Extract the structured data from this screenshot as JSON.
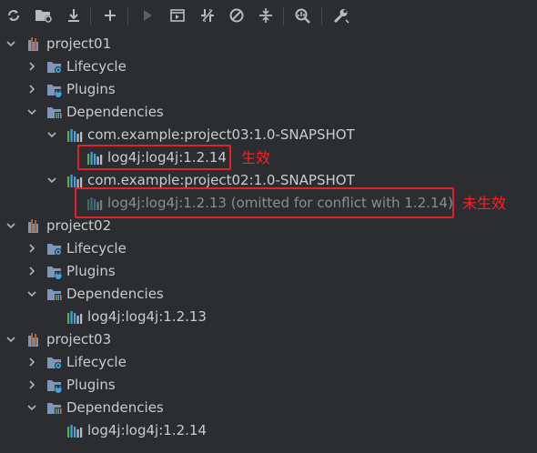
{
  "toolbar": {
    "buttons": [
      {
        "name": "reload-icon"
      },
      {
        "name": "folder-generate-icon"
      },
      {
        "name": "download-icon"
      },
      {
        "name": "add-icon"
      },
      {
        "name": "run-icon"
      },
      {
        "name": "execute-goal-icon"
      },
      {
        "name": "toggle-offline-icon"
      },
      {
        "name": "skip-tests-icon"
      },
      {
        "name": "collapse-all-icon"
      },
      {
        "name": "analyze-dependencies-icon"
      },
      {
        "name": "settings-wrench-icon"
      }
    ]
  },
  "tree": {
    "project01": {
      "label": "project01",
      "lifecycle": "Lifecycle",
      "plugins": "Plugins",
      "dependencies": "Dependencies",
      "dep_a": "com.example:project03:1.0-SNAPSHOT",
      "dep_a_child": "log4j:log4j:1.2.14",
      "dep_b": "com.example:project02:1.0-SNAPSHOT",
      "dep_b_child": "log4j:log4j:1.2.13 (omitted for conflict with 1.2.14)"
    },
    "project02": {
      "label": "project02",
      "lifecycle": "Lifecycle",
      "plugins": "Plugins",
      "dependencies": "Dependencies",
      "dep": "log4j:log4j:1.2.13"
    },
    "project03": {
      "label": "project03",
      "lifecycle": "Lifecycle",
      "plugins": "Plugins",
      "dependencies": "Dependencies",
      "dep": "log4j:log4j:1.2.14"
    }
  },
  "annotations": {
    "effective": "生效",
    "not_effective": "未生效"
  },
  "colors": {
    "background": "#2b2d30",
    "text": "#c9ccd1",
    "muted_text": "#8a8e95",
    "annotation_red": "#e0232a",
    "folder_blue": "#7f96b8"
  }
}
